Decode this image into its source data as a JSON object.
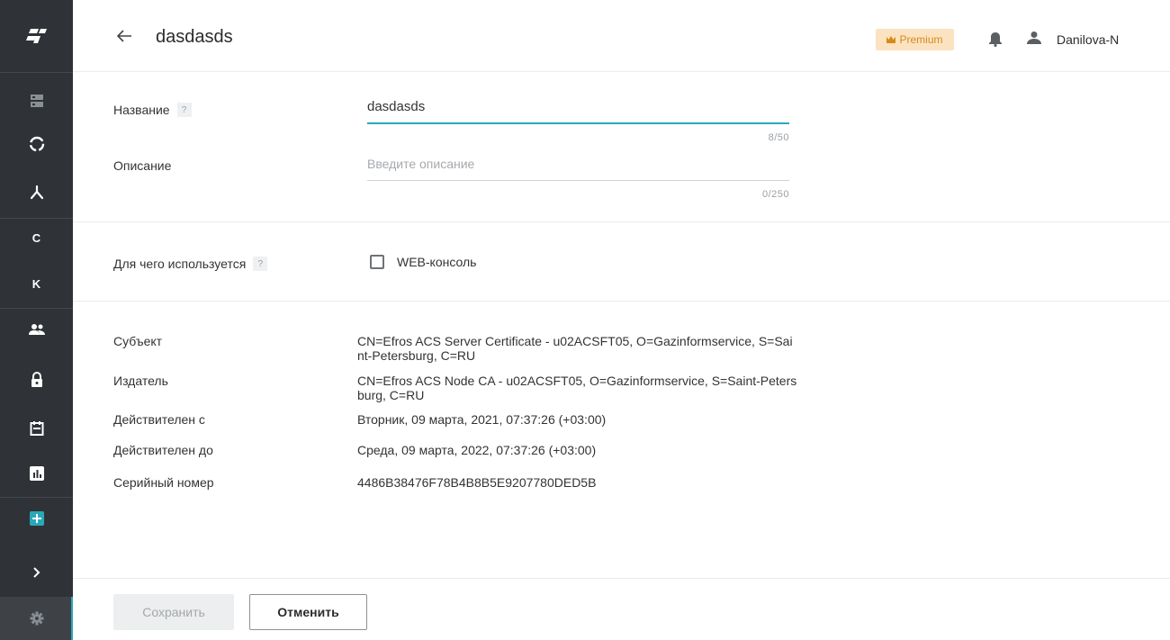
{
  "header": {
    "title": "dasdasds",
    "premium_label": "Premium",
    "username": "Danilova-N"
  },
  "sidebar": {
    "items": [
      {
        "icon": "logo-icon"
      },
      {
        "icon": "servers-icon"
      },
      {
        "icon": "circle-icon"
      },
      {
        "icon": "network-icon"
      },
      {
        "icon": "letter-c",
        "label": "C"
      },
      {
        "icon": "letter-k",
        "label": "K"
      },
      {
        "icon": "users-icon"
      },
      {
        "icon": "lock-icon"
      },
      {
        "icon": "calendar-icon"
      },
      {
        "icon": "report-icon"
      },
      {
        "icon": "add-icon"
      },
      {
        "icon": "chevron-right-icon"
      },
      {
        "icon": "gear-icon"
      }
    ]
  },
  "form": {
    "name_label": "Название",
    "name_value": "dasdasds",
    "name_counter": "8/50",
    "description_label": "Описание",
    "description_placeholder": "Введите описание",
    "description_counter": "0/250",
    "usage_label": "Для чего используется",
    "help_mark": "?",
    "web_console_label": "WEB-консоль",
    "web_console_checked": false
  },
  "certificate": {
    "subject_label": "Субъект",
    "subject_value": "CN=Efros ACS Server Certificate - u02ACSFT05, O=Gazinformservice, S=Saint-Petersburg, C=RU",
    "issuer_label": "Издатель",
    "issuer_value": "CN=Efros ACS Node CA - u02ACSFT05, O=Gazinformservice, S=Saint-Petersburg, C=RU",
    "valid_from_label": "Действителен с",
    "valid_from_value": "Вторник, 09 марта, 2021, 07:37:26 (+03:00)",
    "valid_to_label": "Действителен до",
    "valid_to_value": "Среда, 09 марта, 2022, 07:37:26 (+03:00)",
    "serial_label": "Серийный номер",
    "serial_value": "4486B38476F78B4B8B5E9207780DED5B"
  },
  "footer": {
    "save_label": "Сохранить",
    "cancel_label": "Отменить"
  },
  "colors": {
    "accent": "#2aa8b9",
    "sidebar_bg": "#2f3236",
    "premium_bg": "#fbe3c2",
    "premium_text": "#d68a1a"
  }
}
